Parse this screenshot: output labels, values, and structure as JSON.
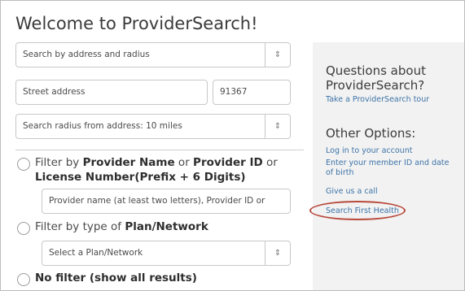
{
  "title": "Welcome to ProviderSearch!",
  "search_form": {
    "search_type_select": {
      "value": "Search by address and radius"
    },
    "street_address": {
      "placeholder": "Street address"
    },
    "zip_code": {
      "value": "91367"
    },
    "radius_select": {
      "value": "Search radius from address: 10 miles"
    }
  },
  "filters": {
    "provider_name_option": {
      "line1_prefix": "Filter by ",
      "line1_bold1": "Provider Name",
      "line1_mid": " or ",
      "line1_bold2": "Provider ID",
      "line1_suffix": " or",
      "line2_bold": "License Number(Prefix + 6 Digits)",
      "input_placeholder": "Provider name (at least two letters), Provider ID or"
    },
    "plan_option": {
      "prefix": "Filter by type of ",
      "bold": "Plan/Network",
      "select_value": "Select a Plan/Network"
    },
    "no_filter_option": {
      "bold": "No filter (show all results)"
    }
  },
  "sidebar": {
    "questions_heading": "Questions about ProviderSearch?",
    "tour_link": "Take a ProviderSearch tour",
    "other_options_heading": "Other Options:",
    "login_link": "Log in to your account",
    "member_id_link": "Enter your member ID and date of birth",
    "call_link": "Give us a call",
    "first_health_link": "Search First Health"
  },
  "colors": {
    "link": "#3d74a8",
    "highlight_circle": "#b84a3c",
    "sidebar_bg": "#f2f2f2"
  },
  "icons": {
    "select_arrow": "up-down-chevron-icon"
  }
}
